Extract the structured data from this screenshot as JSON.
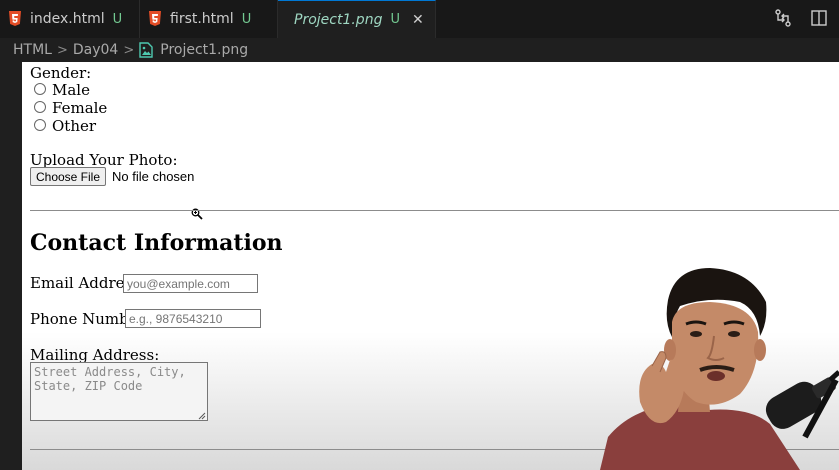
{
  "tabs": [
    {
      "name": "index.html",
      "status": "U",
      "icon": "html5-icon"
    },
    {
      "name": "first.html",
      "status": "U",
      "icon": "html5-icon"
    },
    {
      "name": "Project1.png",
      "status": "U",
      "icon": "image-icon",
      "active": true
    }
  ],
  "close_glyph": "✕",
  "breadcrumb": [
    "HTML",
    "Day04",
    "Project1.png"
  ],
  "form": {
    "gender_label": "Gender:",
    "gender_options": [
      "Male",
      "Female",
      "Other"
    ],
    "upload_label": "Upload Your Photo:",
    "choose_file": "Choose File",
    "no_file": "No file chosen",
    "contact_heading": "Contact Information",
    "email_label": "Email Address:",
    "email_placeholder": "you@example.com",
    "phone_label": "Phone Number:",
    "phone_placeholder": "e.g., 9876543210",
    "mailing_label": "Mailing Address:",
    "mailing_placeholder": "Street Address, City,\nState, ZIP Code"
  },
  "colors": {
    "accent": "#0078d4",
    "untracked": "#73c991",
    "html5": "#e44d26",
    "image": "#4ec9b0"
  }
}
